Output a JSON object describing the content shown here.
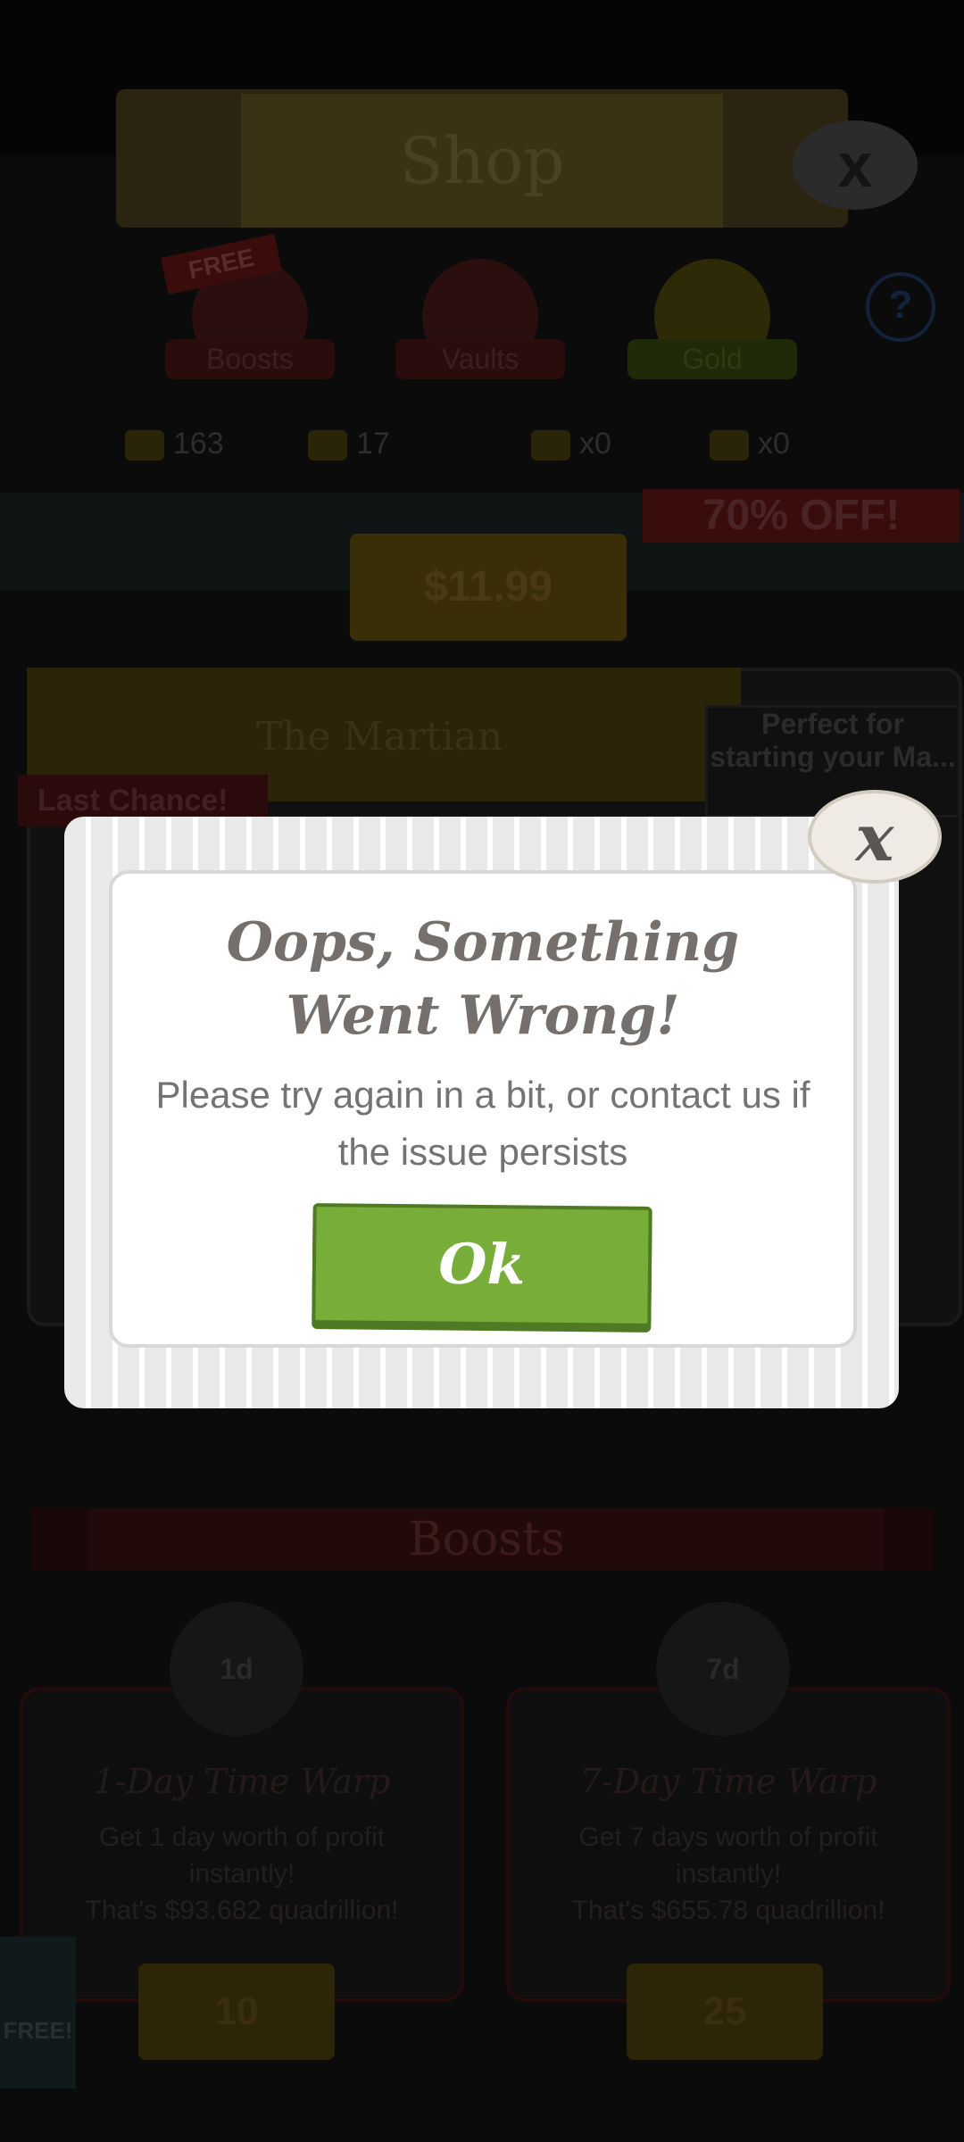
{
  "background": {
    "shop_title": "Shop",
    "close_symbol": "x",
    "tabs": [
      {
        "label": "Boosts",
        "badge": "FREE"
      },
      {
        "label": "Vaults"
      },
      {
        "label": "Gold"
      }
    ],
    "help_symbol": "?",
    "currencies": [
      {
        "icon": "gold-icon",
        "value": "163"
      },
      {
        "icon": "ticket-icon",
        "value": "17"
      },
      {
        "icon": "moneybag-icon",
        "value": "x0"
      },
      {
        "icon": "badge-icon",
        "value": "x0"
      }
    ],
    "offer_label": "70% OFF!",
    "price_label": "$11.99",
    "martian": {
      "title": "The Martian",
      "note": "Perfect for starting your Ma...",
      "last_chance": "Last Chance!"
    },
    "boosts_title": "Boosts",
    "boost_cards": [
      {
        "icon_text": "1d",
        "title": "1-Day Time Warp",
        "desc_1": "Get 1 day worth of profit",
        "desc_2": "instantly!",
        "desc_3": "That's $93.682 quadrillion!",
        "price": "10"
      },
      {
        "icon_text": "7d",
        "title": "7-Day Time Warp",
        "desc_1": "Get 7 days worth of profit",
        "desc_2": "instantly!",
        "desc_3": "That's $655.78 quadrillion!",
        "price": "25"
      }
    ],
    "side_free": "FREE!"
  },
  "dialog": {
    "title": "Oops, Something Went Wrong!",
    "message": "Please try again in a bit, or contact us if the issue persists",
    "ok_label": "Ok",
    "close_symbol": "x"
  },
  "colors": {
    "ok_green": "#79ad3a",
    "ok_border": "#4f7a23",
    "title_gray": "#75706b"
  }
}
